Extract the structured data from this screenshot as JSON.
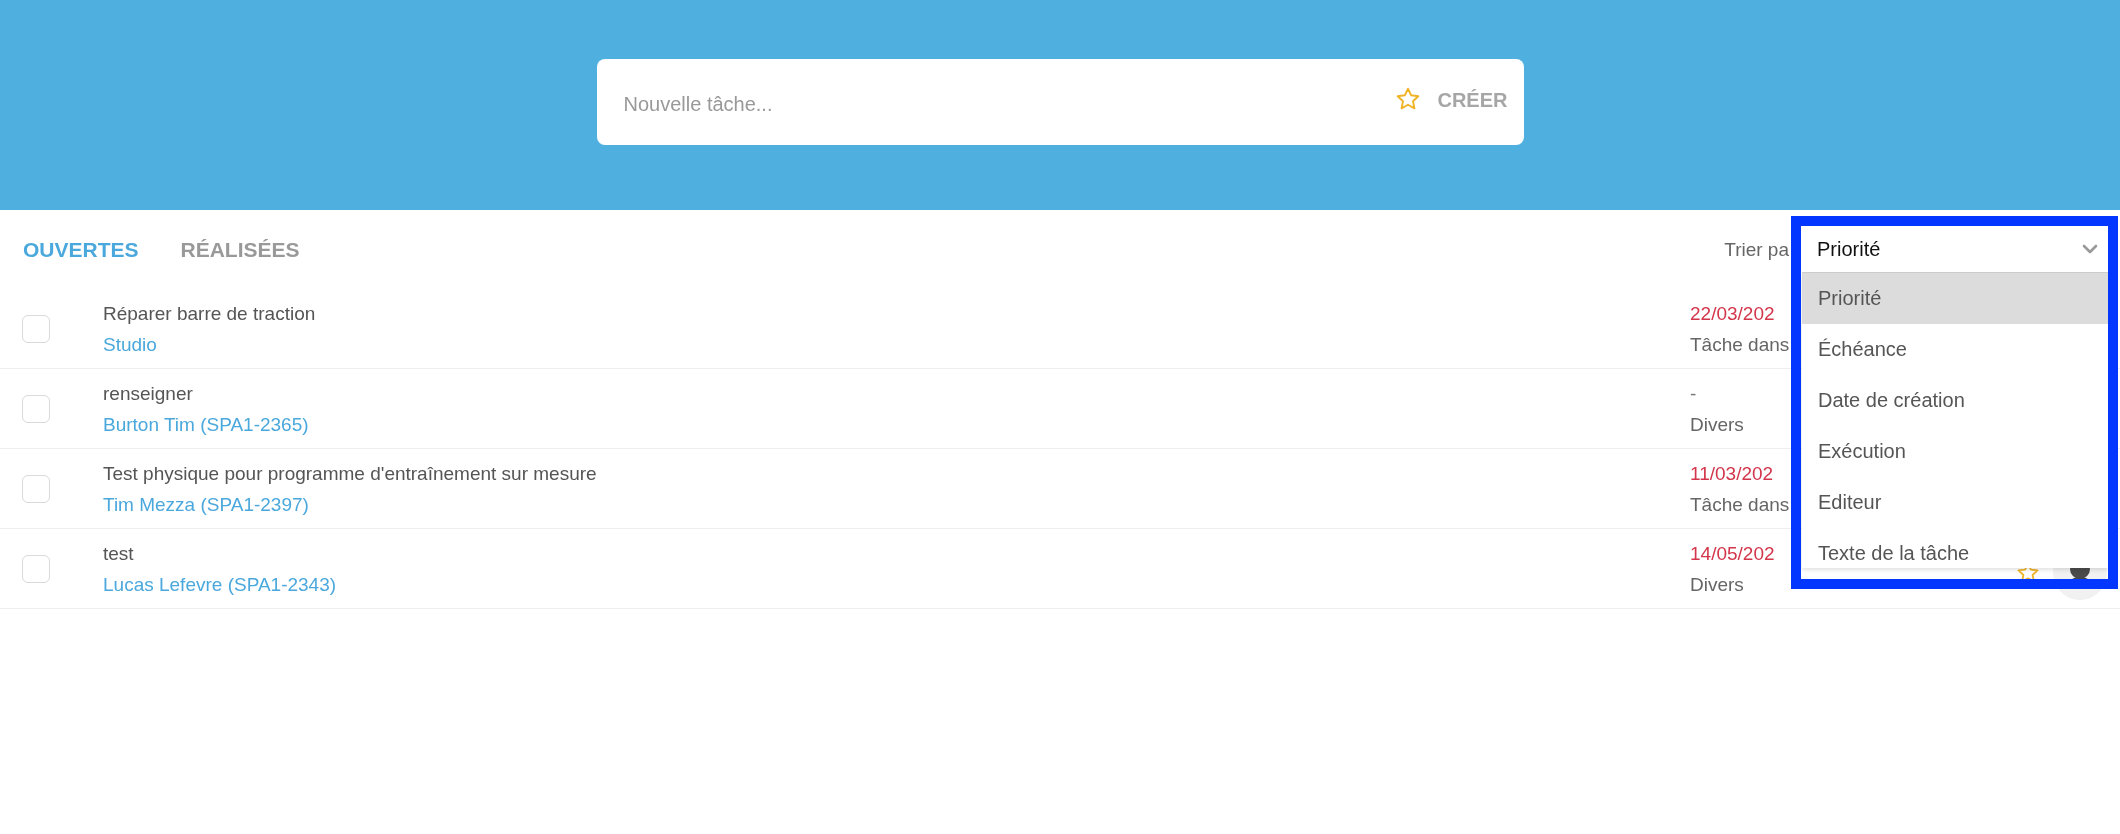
{
  "header": {
    "new_task": {
      "placeholder": "Nouvelle tâche..."
    },
    "create_button": {
      "label": "CRÉER",
      "disabled": true
    }
  },
  "tabs": [
    {
      "label": "OUVERTES",
      "selected": true
    },
    {
      "label": "RÉALISÉES",
      "selected": false
    }
  ],
  "sort": {
    "label": "Trier pa",
    "value": "Priorité",
    "expanded": true,
    "options": [
      {
        "label": "Priorité",
        "selected": true
      },
      {
        "label": "Échéance",
        "selected": false
      },
      {
        "label": "Date de création",
        "selected": false
      },
      {
        "label": "Exécution",
        "selected": false
      },
      {
        "label": "Editeur",
        "selected": false
      },
      {
        "label": "Texte de la tâche",
        "selected": false
      }
    ]
  },
  "tasks": [
    {
      "checked": false,
      "title": "Réparer barre de traction",
      "subtitle": "Studio",
      "date": "22/03/202",
      "overdue": true,
      "category": "Tâche dans"
    },
    {
      "checked": false,
      "title": "renseigner",
      "subtitle": "Burton Tim (SPA1-2365)",
      "date": "-",
      "overdue": false,
      "category": "Divers"
    },
    {
      "checked": false,
      "title": "Test physique pour programme d'entraînement sur mesure",
      "subtitle": "Tim Mezza (SPA1-2397)",
      "date": "11/03/202",
      "overdue": true,
      "category": "Tâche dans"
    },
    {
      "checked": false,
      "title": "test",
      "subtitle": "Lucas Lefevre (SPA1-2343)",
      "date": "14/05/202",
      "overdue": true,
      "category": "Divers"
    }
  ]
}
